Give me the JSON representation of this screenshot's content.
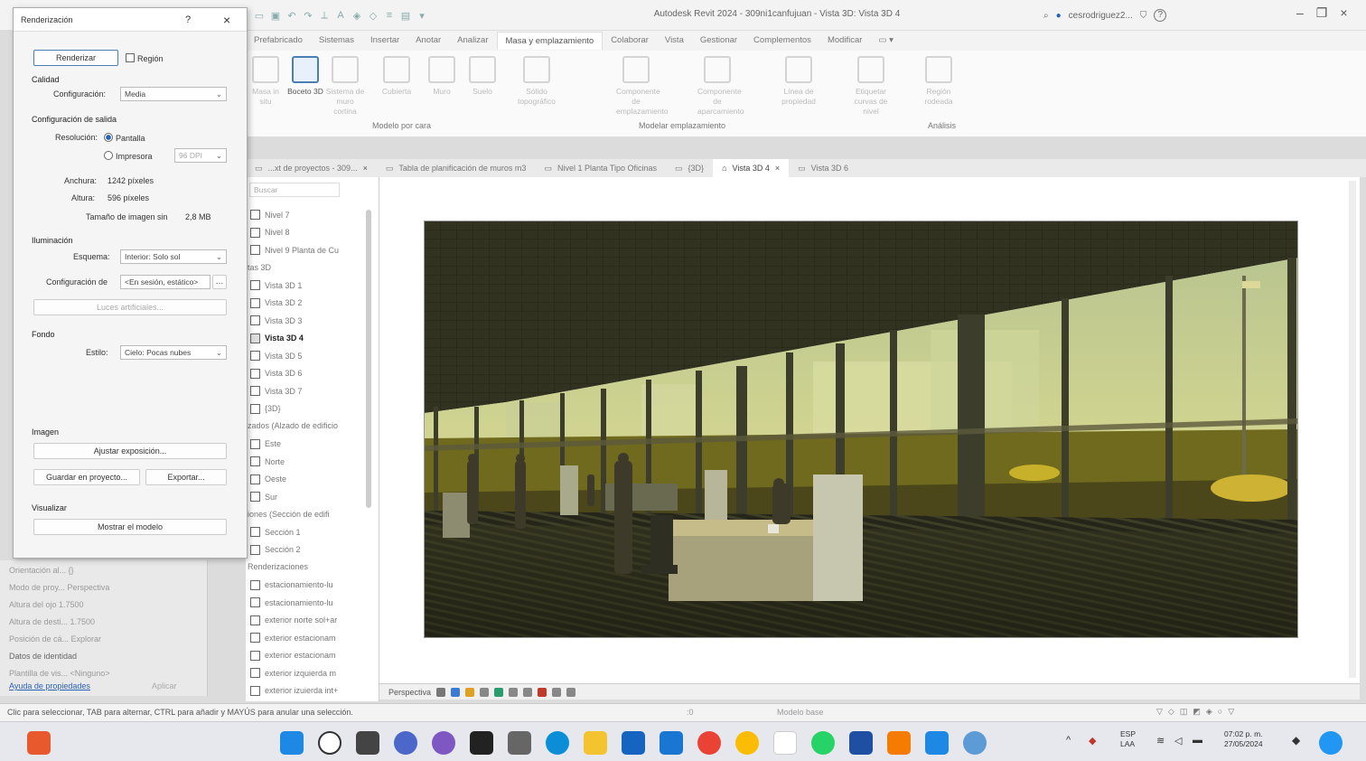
{
  "app": {
    "title": "Autodesk Revit 2024 - 309ni1canfujuan - Vista 3D: Vista 3D 4",
    "user": "cesrodriguez2...",
    "help": "?"
  },
  "ribbon": {
    "tabs": [
      "Prefabricado",
      "Sistemas",
      "Insertar",
      "Anotar",
      "Analizar",
      "Masa y emplazamiento",
      "Colaborar",
      "Vista",
      "Gestionar",
      "Complementos",
      "Modificar"
    ],
    "active_tab": "Masa y emplazamiento",
    "buttons": [
      {
        "label": "Masa in situ"
      },
      {
        "label": "Boceto 3D"
      },
      {
        "label": "Sistema de muro cortina"
      },
      {
        "label": "Cubierta"
      },
      {
        "label": "Muro"
      },
      {
        "label": "Suelo"
      },
      {
        "label": "Sólido topográfico"
      },
      {
        "label": "Componente de emplazamiento"
      },
      {
        "label": "Componente de aparcamiento"
      },
      {
        "label": "Línea de propiedad"
      },
      {
        "label": "Etiquetar curvas de nivel"
      },
      {
        "label": "Región rodeada"
      }
    ],
    "groups": [
      "Modelo por cara",
      "Modelar emplazamiento",
      "Análisis"
    ]
  },
  "doc_tabs": [
    {
      "label": "...xt de proyectos - 309...",
      "active": false
    },
    {
      "label": "Tabla de planificación de muros m3",
      "active": false
    },
    {
      "label": "Nivel 1 Planta Tipo Oficinas",
      "active": false
    },
    {
      "label": "{3D}",
      "active": false
    },
    {
      "label": "Vista 3D 4",
      "active": true
    },
    {
      "label": "Vista 3D 6",
      "active": false
    }
  ],
  "browser": {
    "search_placeholder": "Buscar",
    "items": [
      {
        "label": "Nivel 7",
        "type": "item"
      },
      {
        "label": "Nivel 8",
        "type": "item"
      },
      {
        "label": "Nivel 9 Planta de Cu",
        "type": "item"
      },
      {
        "label": "tas 3D",
        "type": "header"
      },
      {
        "label": "Vista 3D 1",
        "type": "item"
      },
      {
        "label": "Vista 3D 2",
        "type": "item"
      },
      {
        "label": "Vista 3D 3",
        "type": "item"
      },
      {
        "label": "Vista 3D 4",
        "type": "selected"
      },
      {
        "label": "Vista 3D 5",
        "type": "item"
      },
      {
        "label": "Vista 3D 6",
        "type": "item"
      },
      {
        "label": "Vista 3D 7",
        "type": "item"
      },
      {
        "label": "{3D}",
        "type": "item"
      },
      {
        "label": "zados (Alzado de edificio",
        "type": "header"
      },
      {
        "label": "Este",
        "type": "item"
      },
      {
        "label": "Norte",
        "type": "item"
      },
      {
        "label": "Oeste",
        "type": "item"
      },
      {
        "label": "Sur",
        "type": "item"
      },
      {
        "label": "iones (Sección de edifi",
        "type": "header"
      },
      {
        "label": "Sección 1",
        "type": "item"
      },
      {
        "label": "Sección 2",
        "type": "item"
      },
      {
        "label": "Renderizaciones",
        "type": "header"
      },
      {
        "label": "estacionamiento-lu",
        "type": "item"
      },
      {
        "label": "estacionamiento-lu",
        "type": "item"
      },
      {
        "label": "exterior norte sol+ar",
        "type": "item"
      },
      {
        "label": "exterior estacionam",
        "type": "item"
      },
      {
        "label": "exterior estacionam",
        "type": "item"
      },
      {
        "label": "exterior izquierda m",
        "type": "item"
      },
      {
        "label": "exterior izuierda int+",
        "type": "item"
      }
    ]
  },
  "properties": {
    "rows": [
      "Orientación al...  {}",
      "Modo de proy...  Perspectiva",
      "Altura del ojo  1.7500",
      "Altura de desti...  1.7500",
      "Posición de cá...  Explorar",
      "Datos de identidad",
      "Plantilla de vis...  <Ninguno>"
    ],
    "help_link": "Ayuda de propiedades",
    "apply": "Aplicar"
  },
  "view_bar": {
    "projection": "Perspectiva"
  },
  "status_bar": {
    "text": "Clic para seleccionar, TAB para alternar, CTRL para añadir y MAYÚS para anular una selección.",
    "model": "Modelo base",
    "zero": ":0"
  },
  "taskbar": {
    "lang": "ESP",
    "lang2": "LAA",
    "time": "07:02 p. m.",
    "date": "27/05/2024"
  },
  "dialog": {
    "title": "Renderización",
    "help": "?",
    "render_button": "Renderizar",
    "region_label": "Región",
    "quality_section": "Calidad",
    "setting_label": "Configuración:",
    "setting_value": "Media",
    "output_section": "Configuración de salida",
    "resolution_label": "Resolución:",
    "screen_label": "Pantalla",
    "printer_label": "Impresora",
    "printer_dpi": "96 DPI",
    "width_label": "Anchura:",
    "width_value": "1242 píxeles",
    "height_label": "Altura:",
    "height_value": "596 píxeles",
    "size_label": "Tamaño de imagen sin",
    "size_value": "2,8 MB",
    "lighting_section": "Iluminación",
    "scheme_label": "Esquema:",
    "scheme_value": "Interior: Solo sol",
    "sun_label": "Configuración de",
    "sun_value": "<En sesión, estático>",
    "artificial_lights": "Luces artificiales...",
    "background_section": "Fondo",
    "style_label": "Estilo:",
    "style_value": "Cielo: Pocas nubes",
    "image_section": "Imagen",
    "adjust_exposure": "Ajustar exposición...",
    "save_project": "Guardar en proyecto...",
    "export": "Exportar...",
    "display_section": "Visualizar",
    "show_model": "Mostrar el modelo"
  }
}
